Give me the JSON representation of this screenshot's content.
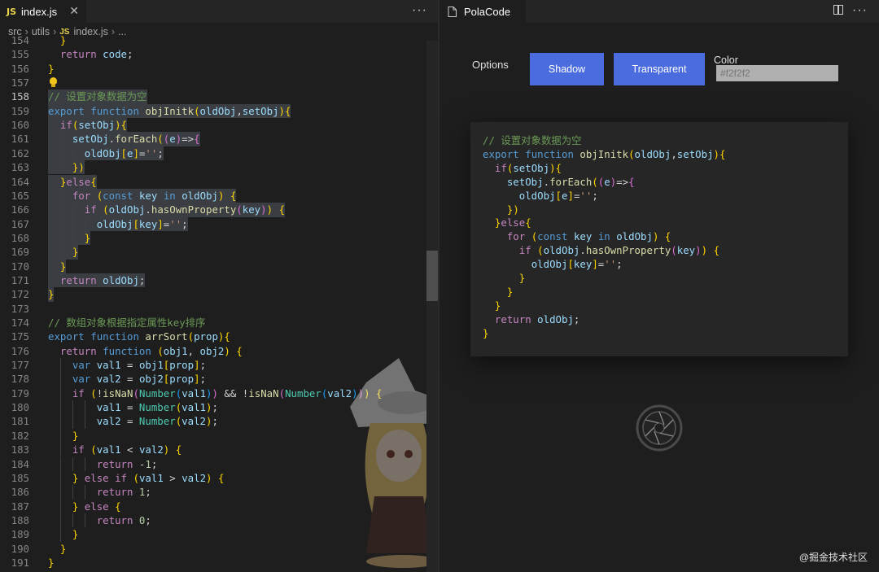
{
  "left_editor": {
    "tab": {
      "badge": "JS",
      "filename": "index.js",
      "close": "✕"
    },
    "more": "···",
    "breadcrumb": {
      "seg1": "src",
      "seg2": "utils",
      "badge": "JS",
      "seg3": "index.js",
      "seg4": "..."
    }
  },
  "right_panel": {
    "tab_title": "PolaCode",
    "more": "···",
    "options_label": "Options",
    "shadow_button": "Shadow",
    "transparent_button": "Transparent",
    "color_label": "Color",
    "color_placeholder": "#f2f2f2"
  },
  "watermark": "@掘金技术社区",
  "colors": {
    "accent_button": "#4a6cde",
    "editor_bg": "#1e1e1e",
    "card_bg": "#262626"
  },
  "icons": [
    "js-file-icon",
    "close-icon",
    "more-icon",
    "file-icon",
    "split-editor-icon",
    "lightbulb-icon",
    "shutter-icon"
  ],
  "code_lines": [
    {
      "n": "154",
      "t": "  }"
    },
    {
      "n": "155",
      "t": "  return code;"
    },
    {
      "n": "156",
      "t": "}"
    },
    {
      "n": "157",
      "t": ""
    },
    {
      "n": "158",
      "t": "// 设置对象数据为空"
    },
    {
      "n": "159",
      "t": "export function objInitk(oldObj,setObj){"
    },
    {
      "n": "160",
      "t": "  if(setObj){"
    },
    {
      "n": "161",
      "t": "    setObj.forEach((e)=>{"
    },
    {
      "n": "162",
      "t": "      oldObj[e]='';"
    },
    {
      "n": "163",
      "t": "    })"
    },
    {
      "n": "164",
      "t": "  }else{"
    },
    {
      "n": "165",
      "t": "    for (const key in oldObj) {"
    },
    {
      "n": "166",
      "t": "      if (oldObj.hasOwnProperty(key)) {"
    },
    {
      "n": "167",
      "t": "        oldObj[key]='';"
    },
    {
      "n": "168",
      "t": "      }"
    },
    {
      "n": "169",
      "t": "    }"
    },
    {
      "n": "170",
      "t": "  }"
    },
    {
      "n": "171",
      "t": "  return oldObj;"
    },
    {
      "n": "172",
      "t": "}"
    },
    {
      "n": "173",
      "t": ""
    },
    {
      "n": "174",
      "t": "// 数组对象根据指定属性key排序"
    },
    {
      "n": "175",
      "t": "export function arrSort(prop){"
    },
    {
      "n": "176",
      "t": "  return function (obj1, obj2) {"
    },
    {
      "n": "177",
      "t": "    var val1 = obj1[prop];"
    },
    {
      "n": "178",
      "t": "    var val2 = obj2[prop];"
    },
    {
      "n": "179",
      "t": "    if (!isNaN(Number(val1)) && !isNaN(Number(val2))) {"
    },
    {
      "n": "180",
      "t": "        val1 = Number(val1);"
    },
    {
      "n": "181",
      "t": "        val2 = Number(val2);"
    },
    {
      "n": "182",
      "t": "    }"
    },
    {
      "n": "183",
      "t": "    if (val1 < val2) {"
    },
    {
      "n": "184",
      "t": "        return -1;"
    },
    {
      "n": "185",
      "t": "    } else if (val1 > val2) {"
    },
    {
      "n": "186",
      "t": "        return 1;"
    },
    {
      "n": "187",
      "t": "    } else {"
    },
    {
      "n": "188",
      "t": "        return 0;"
    },
    {
      "n": "189",
      "t": "    }"
    },
    {
      "n": "190",
      "t": "  }"
    },
    {
      "n": "191",
      "t": "}"
    }
  ],
  "preview_code": [
    "// 设置对象数据为空",
    "export function objInitk(oldObj,setObj){",
    "  if(setObj){",
    "    setObj.forEach((e)=>{",
    "      oldObj[e]='';",
    "    })",
    "  }else{",
    "    for (const key in oldObj) {",
    "      if (oldObj.hasOwnProperty(key)) {",
    "        oldObj[key]='';",
    "      }",
    "    }",
    "  }",
    "  return oldObj;",
    "}"
  ]
}
